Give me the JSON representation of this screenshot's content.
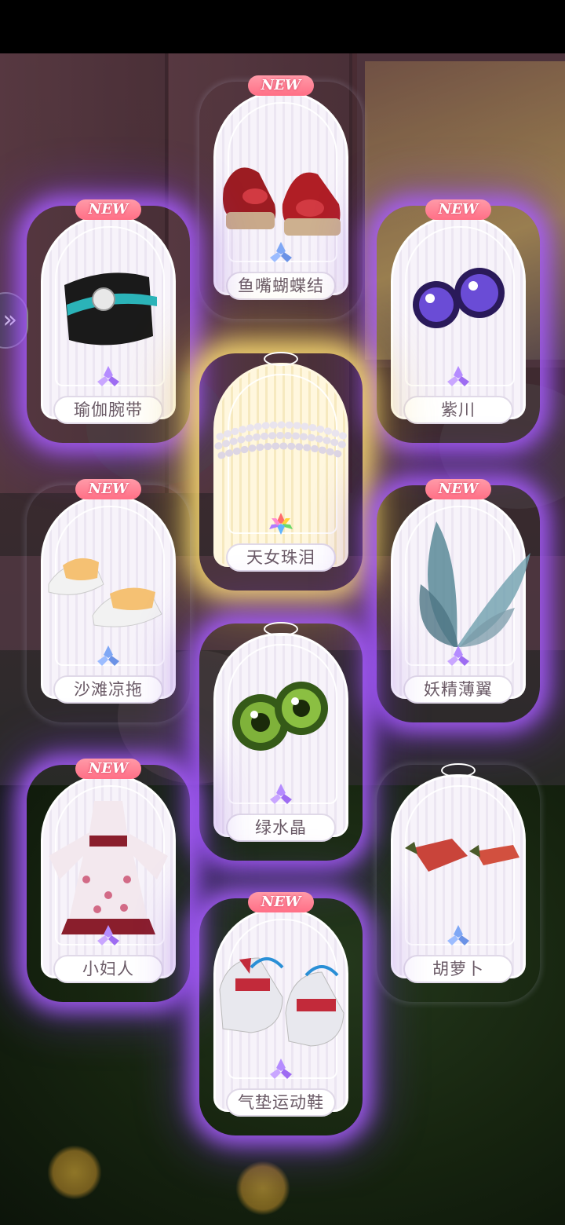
{
  "nav": {
    "side_arrow": "»"
  },
  "badge_text": "NEW",
  "rarity_colors": {
    "purple": "#a77bff",
    "blue": "#8fb3ff",
    "gold": "#ffe078"
  },
  "cards": [
    {
      "label": "鱼嘴蝴蝶结",
      "new": true,
      "rarity": "blue",
      "icon": "wedge-sandals-icon"
    },
    {
      "label": "瑜伽腕带",
      "new": true,
      "rarity": "purple",
      "icon": "wristband-icon"
    },
    {
      "label": "紫川",
      "new": true,
      "rarity": "purple",
      "icon": "purple-eyes-icon"
    },
    {
      "label": "天女珠泪",
      "new": false,
      "rarity": "gold",
      "icon": "pearl-necklace-icon"
    },
    {
      "label": "沙滩凉拖",
      "new": true,
      "rarity": "blue",
      "icon": "slippers-icon"
    },
    {
      "label": "妖精薄翼",
      "new": true,
      "rarity": "purple",
      "icon": "fairy-wings-icon"
    },
    {
      "label": "绿水晶",
      "new": false,
      "rarity": "purple",
      "icon": "green-eyes-icon"
    },
    {
      "label": "小妇人",
      "new": true,
      "rarity": "purple",
      "icon": "dress-icon"
    },
    {
      "label": "胡萝卜",
      "new": false,
      "rarity": "blue",
      "icon": "carrot-clips-icon"
    },
    {
      "label": "气垫运动鞋",
      "new": true,
      "rarity": "purple",
      "icon": "sneakers-icon"
    }
  ]
}
